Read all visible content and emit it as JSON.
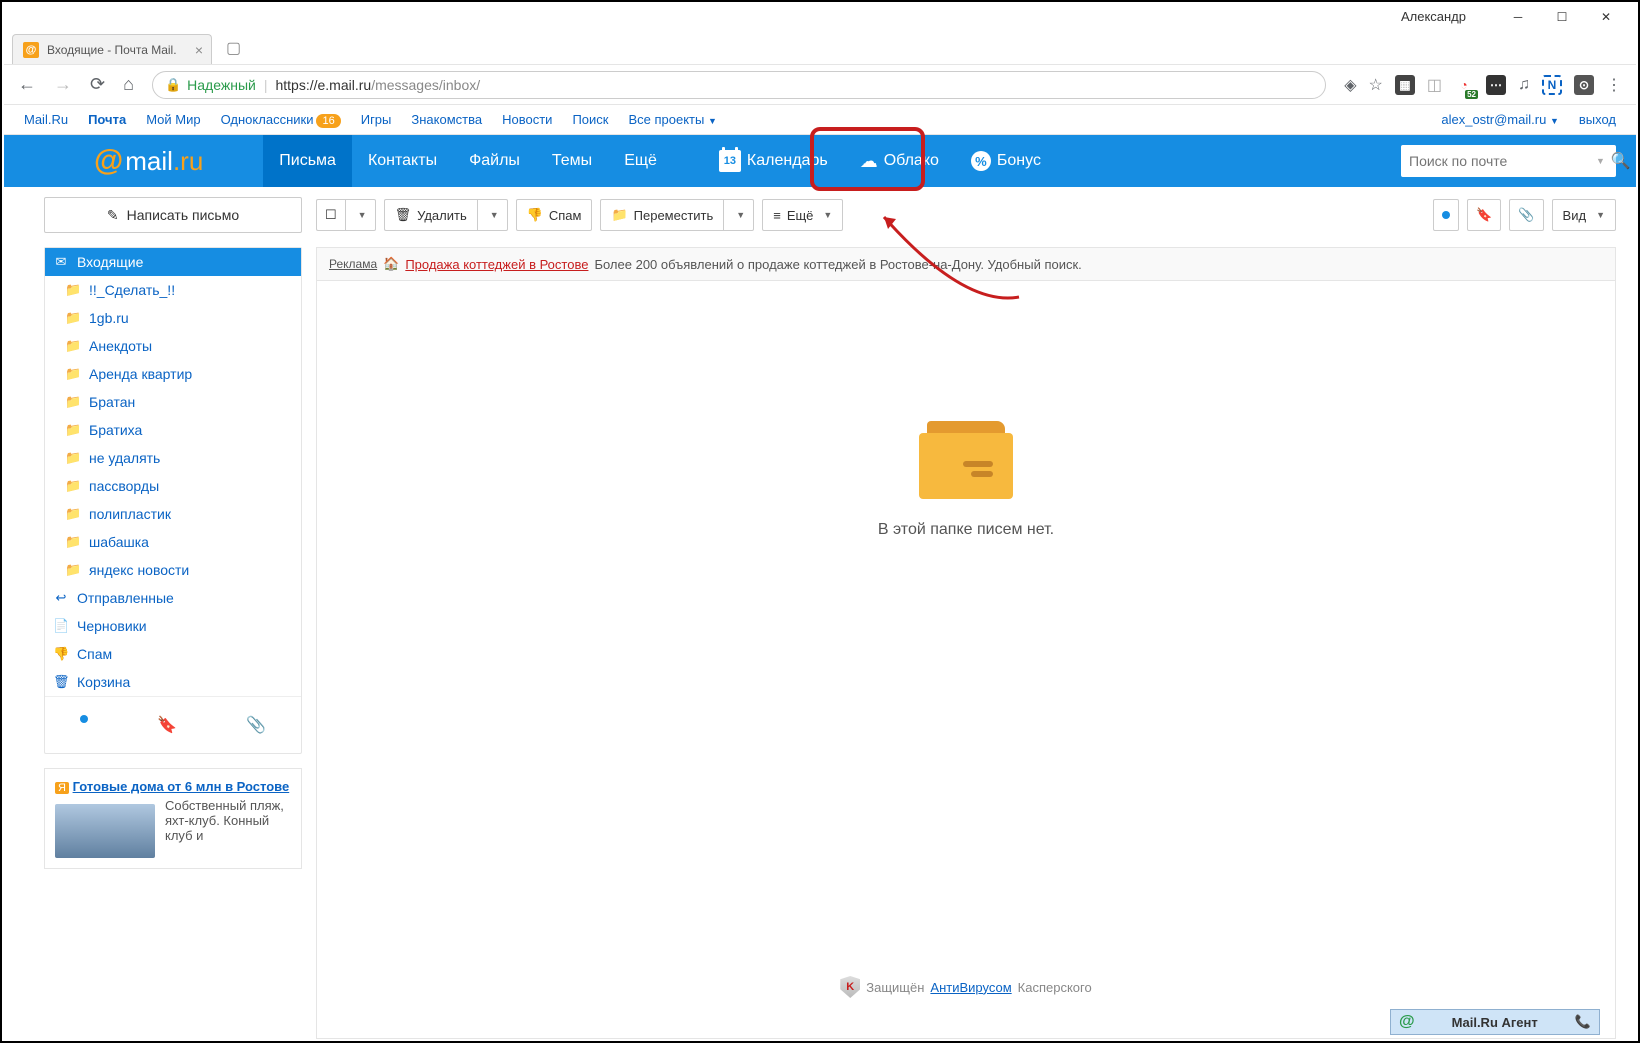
{
  "titlebar": {
    "user": "Александр"
  },
  "browser_tab": {
    "title": "Входящие - Почта Mail."
  },
  "address_bar": {
    "secure_label": "Надежный",
    "url_host": "https://e.mail.ru",
    "url_path": "/messages/inbox/"
  },
  "portal": {
    "links": [
      "Mail.Ru",
      "Почта",
      "Мой Мир",
      "Одноклассники",
      "Игры",
      "Знакомства",
      "Новости",
      "Поиск",
      "Все проекты"
    ],
    "ok_badge": "16",
    "email": "alex_ostr@mail.ru",
    "logout": "выход"
  },
  "bluebar": {
    "logo_text": "mail",
    "logo_suffix": ".ru",
    "nav": {
      "letters": "Письма",
      "contacts": "Контакты",
      "files": "Файлы",
      "themes": "Темы",
      "more": "Ещё"
    },
    "apps": {
      "calendar": "Календарь",
      "calendar_day": "13",
      "cloud": "Облако",
      "bonus": "Бонус"
    },
    "search_placeholder": "Поиск по почте"
  },
  "sidebar": {
    "compose": "Написать письмо",
    "folders": [
      {
        "label": "Входящие",
        "icon": "inbox",
        "active": true,
        "sub": false
      },
      {
        "label": "!!_Сделать_!!",
        "icon": "folder",
        "sub": true
      },
      {
        "label": "1gb.ru",
        "icon": "folder",
        "sub": true
      },
      {
        "label": "Анекдоты",
        "icon": "folder",
        "sub": true
      },
      {
        "label": "Аренда квартир",
        "icon": "folder",
        "sub": true
      },
      {
        "label": "Братан",
        "icon": "folder",
        "sub": true
      },
      {
        "label": "Братиха",
        "icon": "folder",
        "sub": true
      },
      {
        "label": "не удалять",
        "icon": "folder",
        "sub": true
      },
      {
        "label": "пассворды",
        "icon": "folder",
        "sub": true
      },
      {
        "label": "полипластик",
        "icon": "folder",
        "sub": true
      },
      {
        "label": "шабашка",
        "icon": "folder",
        "sub": true
      },
      {
        "label": "яндекс новости",
        "icon": "folder",
        "sub": true
      },
      {
        "label": "Отправленные",
        "icon": "sent",
        "sub": false
      },
      {
        "label": "Черновики",
        "icon": "draft",
        "sub": false
      },
      {
        "label": "Спам",
        "icon": "spam",
        "sub": false
      },
      {
        "label": "Корзина",
        "icon": "trash",
        "sub": false
      }
    ],
    "ad": {
      "title_prefix": "Готовые дома от 6 млн в Ростове",
      "desc": "Собственный пляж, яхт-клуб. Конный клуб и"
    }
  },
  "toolbar": {
    "delete": "Удалить",
    "spam": "Спам",
    "move": "Переместить",
    "more": "Ещё",
    "view": "Вид"
  },
  "ad_top": {
    "label": "Реклама",
    "link": "Продажа коттеджей в Ростове",
    "text": "Более 200 объявлений о продаже коттеджей в Ростове-на-Дону. Удобный поиск."
  },
  "empty": {
    "text": "В этой папке писем нет."
  },
  "antivirus": {
    "prefix": "Защищён",
    "link": "АнтиВирусом",
    "suffix": "Касперского"
  },
  "agent": {
    "label": "Mail.Ru Агент"
  }
}
